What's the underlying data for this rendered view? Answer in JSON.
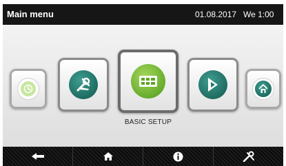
{
  "header": {
    "title": "Main menu",
    "date": "01.08.2017",
    "weekday_time": "We 1:00"
  },
  "menu": {
    "selected_label": "BASIC SETUP",
    "items": [
      {
        "icon": "clock-icon",
        "accent": "#b5de85"
      },
      {
        "icon": "tools-icon",
        "accent": "#1e7a6b"
      },
      {
        "icon": "building-icon",
        "accent": "#7cc03a"
      },
      {
        "icon": "flag-icon",
        "accent": "#1e7a6b"
      },
      {
        "icon": "house-icon",
        "accent": "#1e7a6b"
      }
    ]
  },
  "navigation": {
    "buttons": [
      "back-arrow-icon",
      "home-icon",
      "info-icon",
      "service-tools-icon"
    ]
  },
  "colors": {
    "topbar": "#161616",
    "teal": "#1e7a6b",
    "green": "#7cc03a"
  }
}
